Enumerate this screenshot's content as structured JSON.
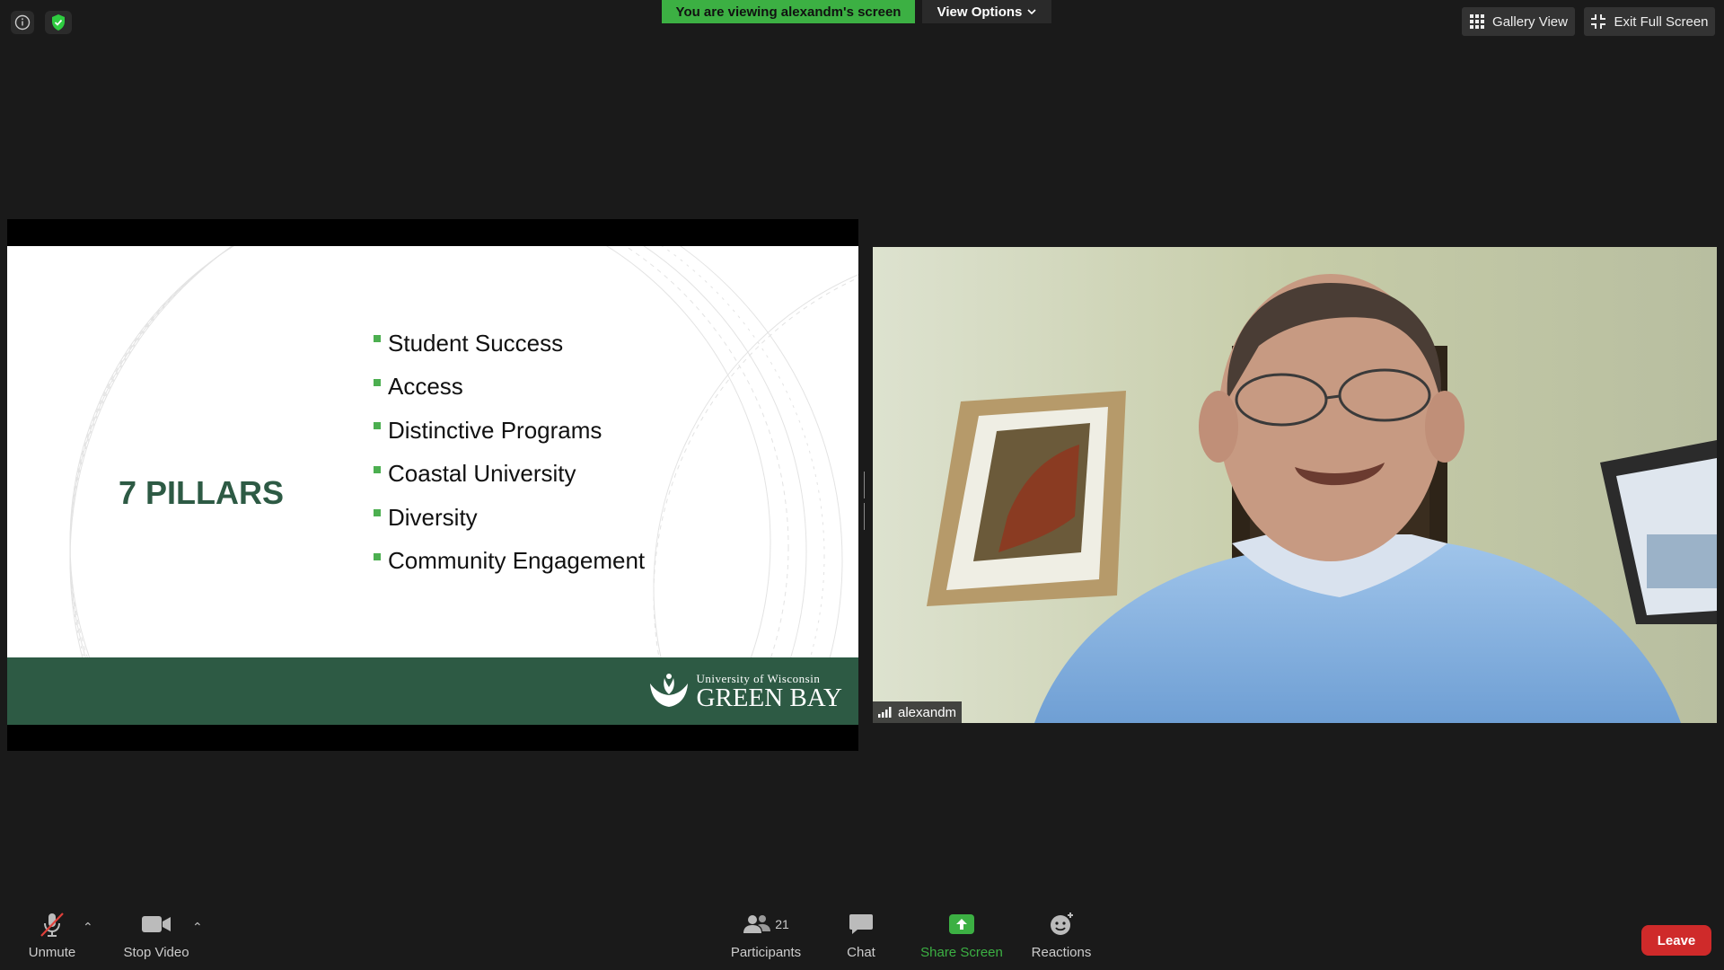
{
  "banner": {
    "viewing_text": "You are viewing alexandm's screen",
    "view_options_label": "View Options",
    "color": "#3cb043"
  },
  "top_right": {
    "gallery_view_label": "Gallery View",
    "exit_full_screen_label": "Exit Full Screen"
  },
  "slide": {
    "title": "7 PILLARS",
    "items": [
      "Student Success",
      "Access",
      "Distinctive Programs",
      "Coastal University",
      "Diversity",
      "Community Engagement"
    ],
    "logo_line1": "University of Wisconsin",
    "logo_line2": "GREEN BAY",
    "theme_color": "#2d5a44",
    "bullet_color": "#4caf50"
  },
  "participant": {
    "name": "alexandm"
  },
  "toolbar": {
    "unmute_label": "Unmute",
    "stop_video_label": "Stop Video",
    "participants_label": "Participants",
    "participants_count": "21",
    "chat_label": "Chat",
    "share_screen_label": "Share Screen",
    "reactions_label": "Reactions",
    "leave_label": "Leave",
    "share_color": "#3cb043",
    "leave_color": "#cf2a2a"
  }
}
